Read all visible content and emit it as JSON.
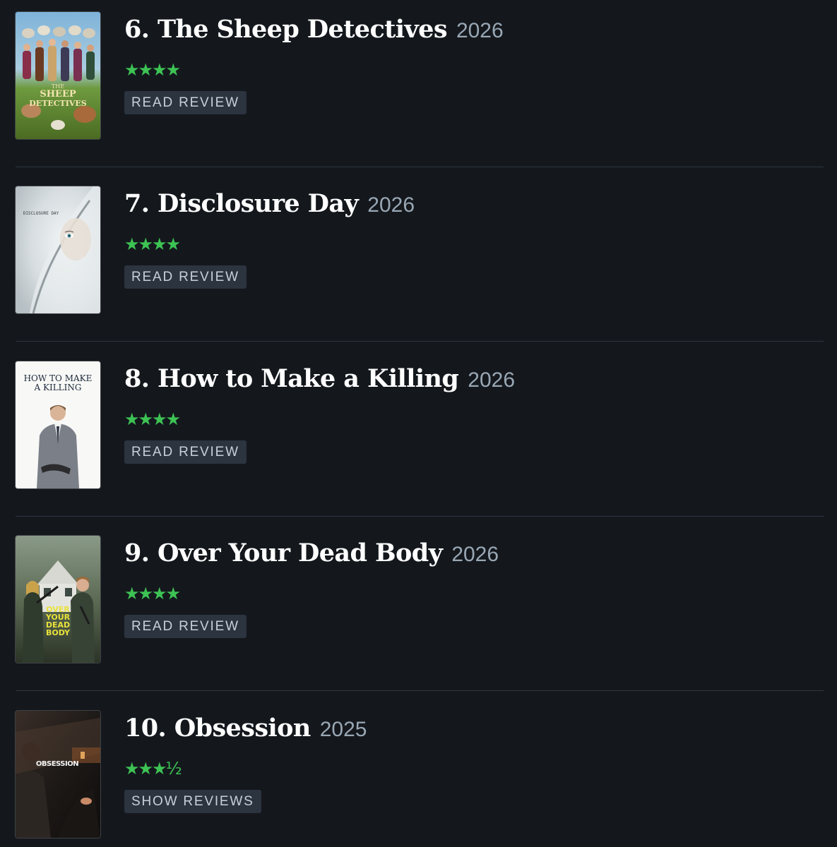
{
  "films": [
    {
      "rank": "6.",
      "title": "The Sheep Detectives",
      "year": "2026",
      "rating": "★★★★",
      "action": "READ REVIEW",
      "poster_text": "THE SHEEP DETECTIVES"
    },
    {
      "rank": "7.",
      "title": "Disclosure Day",
      "year": "2026",
      "rating": "★★★★",
      "action": "READ REVIEW",
      "poster_text": "DISCLOSURE DAY"
    },
    {
      "rank": "8.",
      "title": "How to Make a Killing",
      "year": "2026",
      "rating": "★★★★",
      "action": "READ REVIEW",
      "poster_text": "HOW TO MAKE A KILLING"
    },
    {
      "rank": "9.",
      "title": "Over Your Dead Body",
      "year": "2026",
      "rating": "★★★★",
      "action": "READ REVIEW",
      "poster_text": "OVER YOUR DEAD BODY"
    },
    {
      "rank": "10.",
      "title": "Obsession",
      "year": "2025",
      "rating": "★★★½",
      "action": "SHOW REVIEWS",
      "poster_text": "OBSESSION"
    }
  ],
  "colors": {
    "background": "#14181d",
    "star": "#3dc354",
    "year": "#99a7b4",
    "button_bg": "#2c3440",
    "button_text": "#c6d0da",
    "divider": "#2e3742"
  }
}
